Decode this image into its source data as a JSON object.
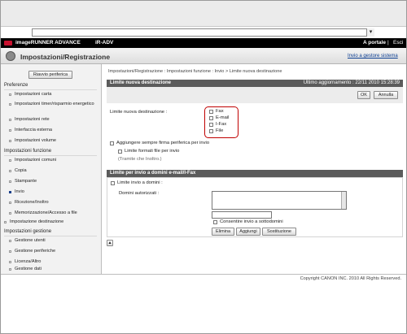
{
  "header": {
    "brand": "imageRUNNER ADVANCE",
    "model": "iR-ADV",
    "portal_link": "A portale",
    "separator": "|",
    "logout": "Esci"
  },
  "title_bar": {
    "title": "Impostazioni/Registrazione",
    "to_send_manager": "Invio a gestore sistema"
  },
  "sidebar": {
    "restart_button": "Riavvio periferica",
    "sections": [
      {
        "heading": "Preferenze",
        "items": [
          "Impostazioni carta",
          "Impostazioni timer/risparmio energetico",
          "Impostazioni rete",
          "Interfaccia esterna",
          "Impostazioni volume"
        ]
      },
      {
        "heading": "Impostazioni funzione",
        "items": [
          "Impostazioni comuni",
          "Copia",
          "Stampante",
          "Invio",
          "Ricezione/Inoltro",
          "Memorizzazione/Accesso a file"
        ]
      },
      {
        "heading": "Impostazione destinazione",
        "items": []
      },
      {
        "heading": "Impostazioni gestione",
        "items": [
          "Gestione utenti",
          "Gestione periferiche",
          "Licenza/Altro",
          "Gestione dati"
        ]
      }
    ]
  },
  "breadcrumb": "Impostazioni/Registrazione : Impostazioni funzione : Invio > Limite nuova destinazione",
  "main": {
    "section_title": "Limite nuova destinazione",
    "last_update": "Ultimo aggiornamento : 22/11 2010 15:28:39",
    "ok_button": "OK",
    "cancel_button": "Annulla",
    "limit_label": "Limite nuova destinazione :",
    "destinations": [
      "Fax",
      "E-mail",
      "I-Fax",
      "File"
    ],
    "add_signature": "Aggiungere sempre firma periferica per invio",
    "limit_formats": "Limite formati file per invio",
    "limit_formats_note": "(Tramite che Inoltro.)",
    "domain_section_title": "Limite per invio a domini e-mail/I-Fax",
    "limit_domains": "Limite invio a domini :",
    "authorized_domains": "Domini autorizzati :",
    "allow_subdomains": "Consentire invio a sottodomini",
    "delete_button": "Elimina",
    "add_button": "Aggiungi",
    "replace_button": "Sostituzione"
  },
  "footer": {
    "copyright": "Copyright CANON INC. 2010 All Rights Reserved."
  }
}
